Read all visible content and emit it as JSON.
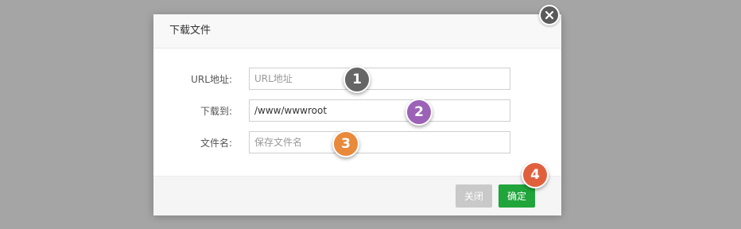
{
  "dialog": {
    "title": "下载文件",
    "fields": [
      {
        "label": "URL地址:",
        "value": "",
        "placeholder": "URL地址"
      },
      {
        "label": "下载到:",
        "value": "/www/wwwroot",
        "placeholder": ""
      },
      {
        "label": "文件名:",
        "value": "",
        "placeholder": "保存文件名"
      }
    ],
    "buttons": {
      "close_label": "关闭",
      "confirm_label": "确定"
    }
  },
  "markers": [
    {
      "number": "1",
      "color": "#666666"
    },
    {
      "number": "2",
      "color": "#9c62b7"
    },
    {
      "number": "3",
      "color": "#e8893c"
    },
    {
      "number": "4",
      "color": "#e0603e"
    }
  ],
  "icons": {
    "close": "close-icon"
  }
}
